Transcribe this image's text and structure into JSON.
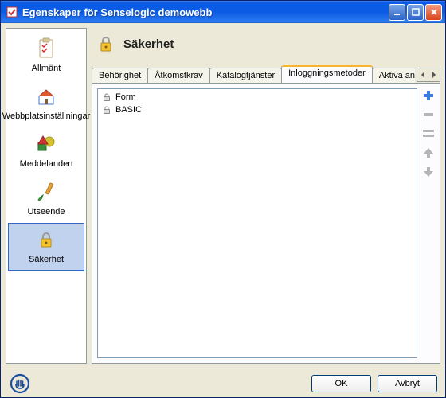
{
  "window": {
    "title": "Egenskaper för Senselogic demowebb"
  },
  "sidebar": {
    "items": [
      {
        "label": "Allmänt",
        "icon": "checklist-icon",
        "selected": false
      },
      {
        "label": "Webbplatsinställningar",
        "icon": "home-icon",
        "selected": false
      },
      {
        "label": "Meddelanden",
        "icon": "shapes-icon",
        "selected": false
      },
      {
        "label": "Utseende",
        "icon": "brush-icon",
        "selected": false
      },
      {
        "label": "Säkerhet",
        "icon": "lock-icon",
        "selected": true
      }
    ]
  },
  "main": {
    "title": "Säkerhet",
    "tabs": [
      {
        "label": "Behörighet",
        "active": false
      },
      {
        "label": "Åtkomstkrav",
        "active": false
      },
      {
        "label": "Katalogtjänster",
        "active": false
      },
      {
        "label": "Inloggningsmetoder",
        "active": true
      },
      {
        "label": "Aktiva använ",
        "active": false
      }
    ],
    "items": [
      {
        "label": "Form"
      },
      {
        "label": "BASIC"
      }
    ]
  },
  "toolbar": {
    "add": "add",
    "remove": "remove",
    "edit": "edit",
    "up": "up",
    "down": "down"
  },
  "footer": {
    "ok": "OK",
    "cancel": "Avbryt"
  }
}
